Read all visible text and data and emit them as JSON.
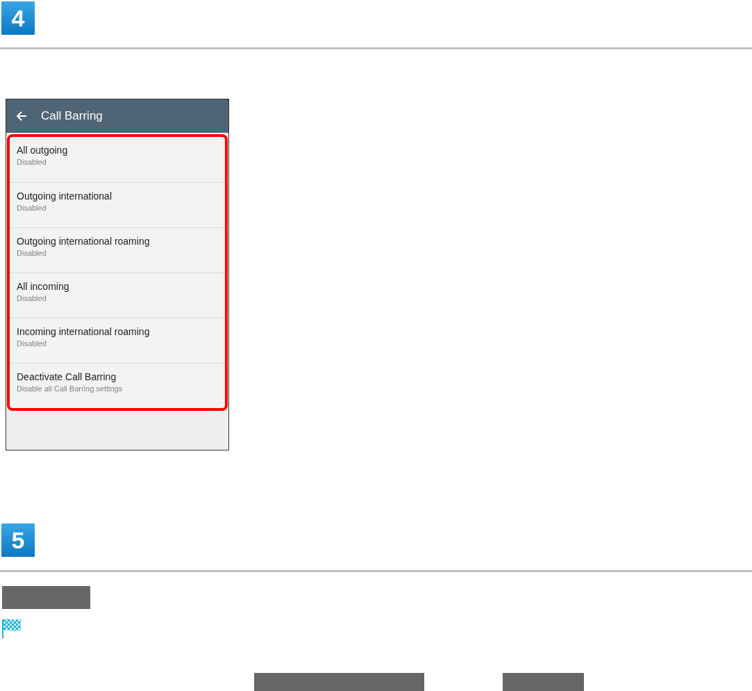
{
  "steps": [
    {
      "number": "4",
      "screen": {
        "title": "Call Barring",
        "highlighted": true,
        "items": [
          {
            "title": "All outgoing",
            "summary": "Disabled"
          },
          {
            "title": "Outgoing international",
            "summary": "Disabled"
          },
          {
            "title": "Outgoing international roaming",
            "summary": "Disabled"
          },
          {
            "title": "All incoming",
            "summary": "Disabled"
          },
          {
            "title": "Incoming international roaming",
            "summary": "Disabled"
          },
          {
            "title": "Deactivate Call Barring",
            "summary": "Disable all Call Barring settings"
          }
        ]
      }
    },
    {
      "number": "5"
    }
  ]
}
